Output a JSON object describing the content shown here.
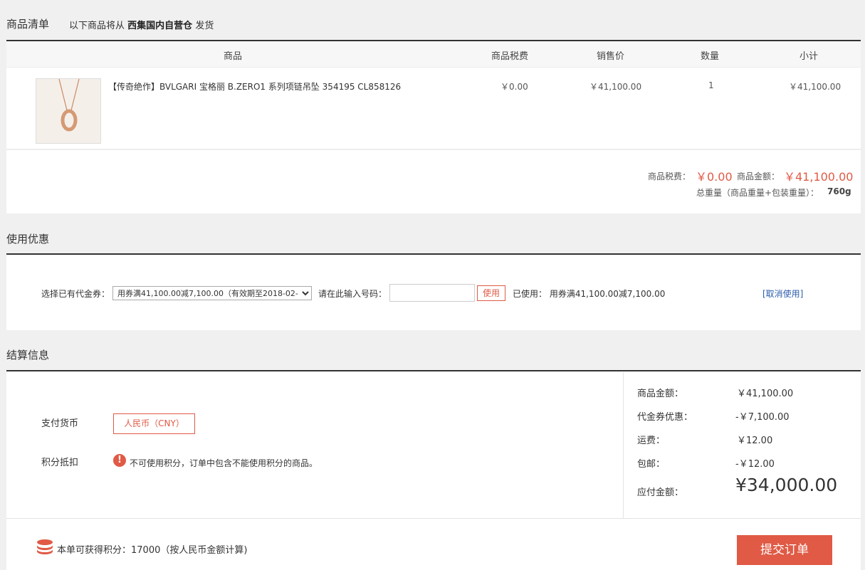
{
  "list": {
    "title": "商品清单",
    "ship_prefix": "以下商品将从",
    "warehouse": "西集国内自营仓",
    "ship_suffix": "发货"
  },
  "table": {
    "headers": [
      "商品",
      "商品税费",
      "销售价",
      "数量",
      "小计"
    ],
    "row": {
      "name": "【传奇绝作】BVLGARI 宝格丽 B.ZERO1 系列项链吊坠 354195 CL858126",
      "tax": "￥0.00",
      "price": "￥41,100.00",
      "qty": "1",
      "subtotal": "￥41,100.00"
    }
  },
  "summary": {
    "tax_label": "商品税费：",
    "tax_value": "￥0.00",
    "amount_label": "商品金额：",
    "amount_value": "￥41,100.00",
    "weight_label": "总重量（商品重量+包装重量）：",
    "weight_value": "760g"
  },
  "coupon": {
    "title": "使用优惠",
    "select_label": "选择已有代金券：",
    "select_value": "用券满41,100.00减7,100.00（有效期至2018-02-",
    "code_label": "请在此输入号码：",
    "code_value": "",
    "use_button": "使用",
    "used_label": "已使用：",
    "used_value": "用券满41,100.00减7,100.00",
    "cancel_link": "[取消使用]"
  },
  "settlement": {
    "title": "结算信息",
    "currency_label": "支付货币",
    "currency_value": "人民币（CNY）",
    "points_label": "积分抵扣",
    "points_warning_icon": "!",
    "points_warning": "不可使用积分，订单中包含不能使用积分的商品。",
    "goods_label": "商品金额：",
    "goods_value": "￥41,100.00",
    "coupon_label": "代金券优惠：",
    "coupon_value": "-￥7,100.00",
    "shipping_label": "运费：",
    "shipping_value": "￥12.00",
    "free_ship_label": "包邮：",
    "free_ship_value": "-￥12.00",
    "payable_label": "应付金额：",
    "payable_value": "¥34,000.00",
    "earn_points": "本单可获得积分：17000（按人民币金额计算)",
    "submit_button": "提交订单"
  },
  "icons": {
    "coins": "coins-icon",
    "warning": "warning-icon",
    "dropdown": "chevron-down-icon"
  },
  "colors": {
    "accent": "#e05a45",
    "link": "#2a5cab"
  }
}
